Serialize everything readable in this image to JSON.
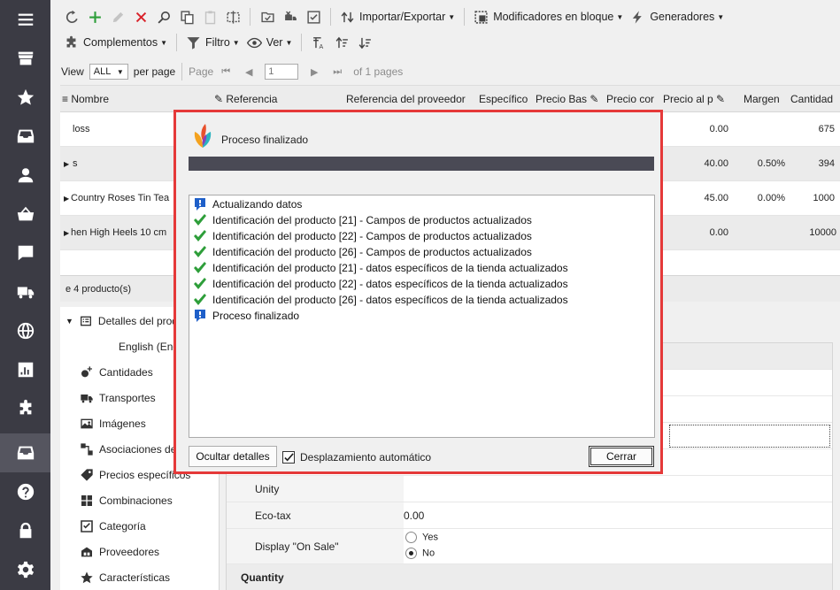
{
  "toolbar1": {
    "import_export": "Importar/Exportar",
    "bulk_modifiers": "Modificadores en bloque",
    "generators": "Generadores"
  },
  "toolbar2": {
    "addons": "Complementos",
    "filter": "Filtro",
    "view": "Ver"
  },
  "pager": {
    "view_label": "View",
    "view_value": "ALL",
    "per_page": "per page",
    "page_label": "Page",
    "page_value": "1",
    "of_pages": "of 1 pages"
  },
  "grid": {
    "columns": [
      "Nombre",
      "Referencia",
      "Referencia del proveedor",
      "Específico",
      "Precio Bas",
      "Precio cor",
      "Precio al p",
      "Margen",
      "Cantidad"
    ],
    "rows": [
      {
        "name": "loss",
        "price": "0.00",
        "margin": "",
        "qty": "675"
      },
      {
        "name": "s",
        "price": "40.00",
        "margin": "0.50%",
        "qty": "394"
      },
      {
        "name": "Country Roses Tin Tea",
        "price": "45.00",
        "margin": "0.00%",
        "qty": "1000"
      },
      {
        "name": "hen High Heels 10 cm",
        "price": "0.00",
        "margin": "",
        "qty": "10000"
      }
    ],
    "footer": "e 4 producto(s)"
  },
  "tree": {
    "items": [
      {
        "label": "Detalles del prod",
        "icon": "list-icon"
      },
      {
        "label": "English (Eng",
        "icon": ""
      },
      {
        "label": "Cantidades",
        "icon": "quantities-icon"
      },
      {
        "label": "Transportes",
        "icon": "truck-icon"
      },
      {
        "label": "Imágenes",
        "icon": "image-icon"
      },
      {
        "label": "Asociaciones de",
        "icon": "associations-icon"
      },
      {
        "label": "Precios específicos",
        "icon": "tag-icon"
      },
      {
        "label": "Combinaciones",
        "icon": "grid-icon"
      },
      {
        "label": "Categoría",
        "icon": "category-icon"
      },
      {
        "label": "Proveedores",
        "icon": "suppliers-icon"
      },
      {
        "label": "Características",
        "icon": "star-icon"
      }
    ]
  },
  "props": {
    "unity_label": "Unity",
    "ecotax_label": "Eco-tax",
    "ecotax_value": "0.00",
    "on_sale_label": "Display \"On Sale\"",
    "yes": "Yes",
    "no": "No",
    "quantity_section": "Quantity"
  },
  "dialog": {
    "title": "Proceso finalizado",
    "log": [
      {
        "type": "info",
        "text": "Actualizando datos"
      },
      {
        "type": "ok",
        "text": "Identificación del producto [21] - Campos de productos actualizados"
      },
      {
        "type": "ok",
        "text": "Identificación del producto [22] - Campos de productos actualizados"
      },
      {
        "type": "ok",
        "text": "Identificación del producto [26] - Campos de productos actualizados"
      },
      {
        "type": "ok",
        "text": "Identificación del producto [21] - datos específicos de la tienda actualizados"
      },
      {
        "type": "ok",
        "text": "Identificación del producto [22] - datos específicos de la tienda actualizados"
      },
      {
        "type": "ok",
        "text": "Identificación del producto [26] - datos específicos de la tienda actualizados"
      },
      {
        "type": "info",
        "text": "Proceso finalizado"
      }
    ],
    "hide_details": "Ocultar detalles",
    "autoscroll": "Desplazamiento automático",
    "close": "Cerrar"
  },
  "colors": {
    "sidebar": "#3b3b44",
    "highlight_border": "#e53939",
    "check_green": "#2e9e3a",
    "info_blue": "#1e5fc9"
  }
}
